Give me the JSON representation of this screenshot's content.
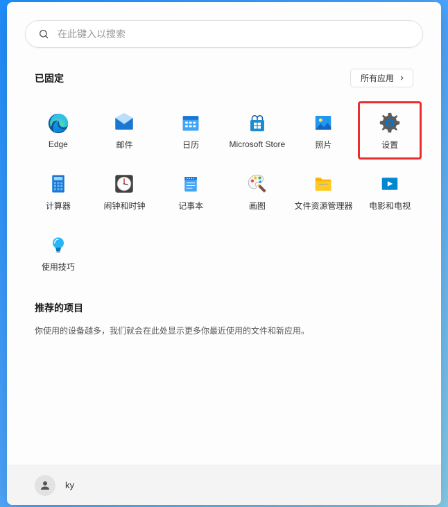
{
  "search": {
    "placeholder": "在此键入以搜索"
  },
  "pinned": {
    "title": "已固定",
    "all_apps": "所有应用",
    "apps": [
      {
        "id": "edge",
        "label": "Edge"
      },
      {
        "id": "mail",
        "label": "邮件"
      },
      {
        "id": "calendar",
        "label": "日历"
      },
      {
        "id": "store",
        "label": "Microsoft Store"
      },
      {
        "id": "photos",
        "label": "照片"
      },
      {
        "id": "settings",
        "label": "设置",
        "highlighted": true
      },
      {
        "id": "calculator",
        "label": "计算器"
      },
      {
        "id": "clock",
        "label": "闹钟和时钟"
      },
      {
        "id": "notepad",
        "label": "记事本"
      },
      {
        "id": "paint",
        "label": "画图"
      },
      {
        "id": "explorer",
        "label": "文件资源管理器"
      },
      {
        "id": "movies",
        "label": "电影和电视"
      },
      {
        "id": "tips",
        "label": "使用技巧"
      }
    ]
  },
  "recommended": {
    "title": "推荐的项目",
    "description": "你使用的设备越多，我们就会在此处显示更多你最近使用的文件和新应用。"
  },
  "user": {
    "name": "ky"
  }
}
